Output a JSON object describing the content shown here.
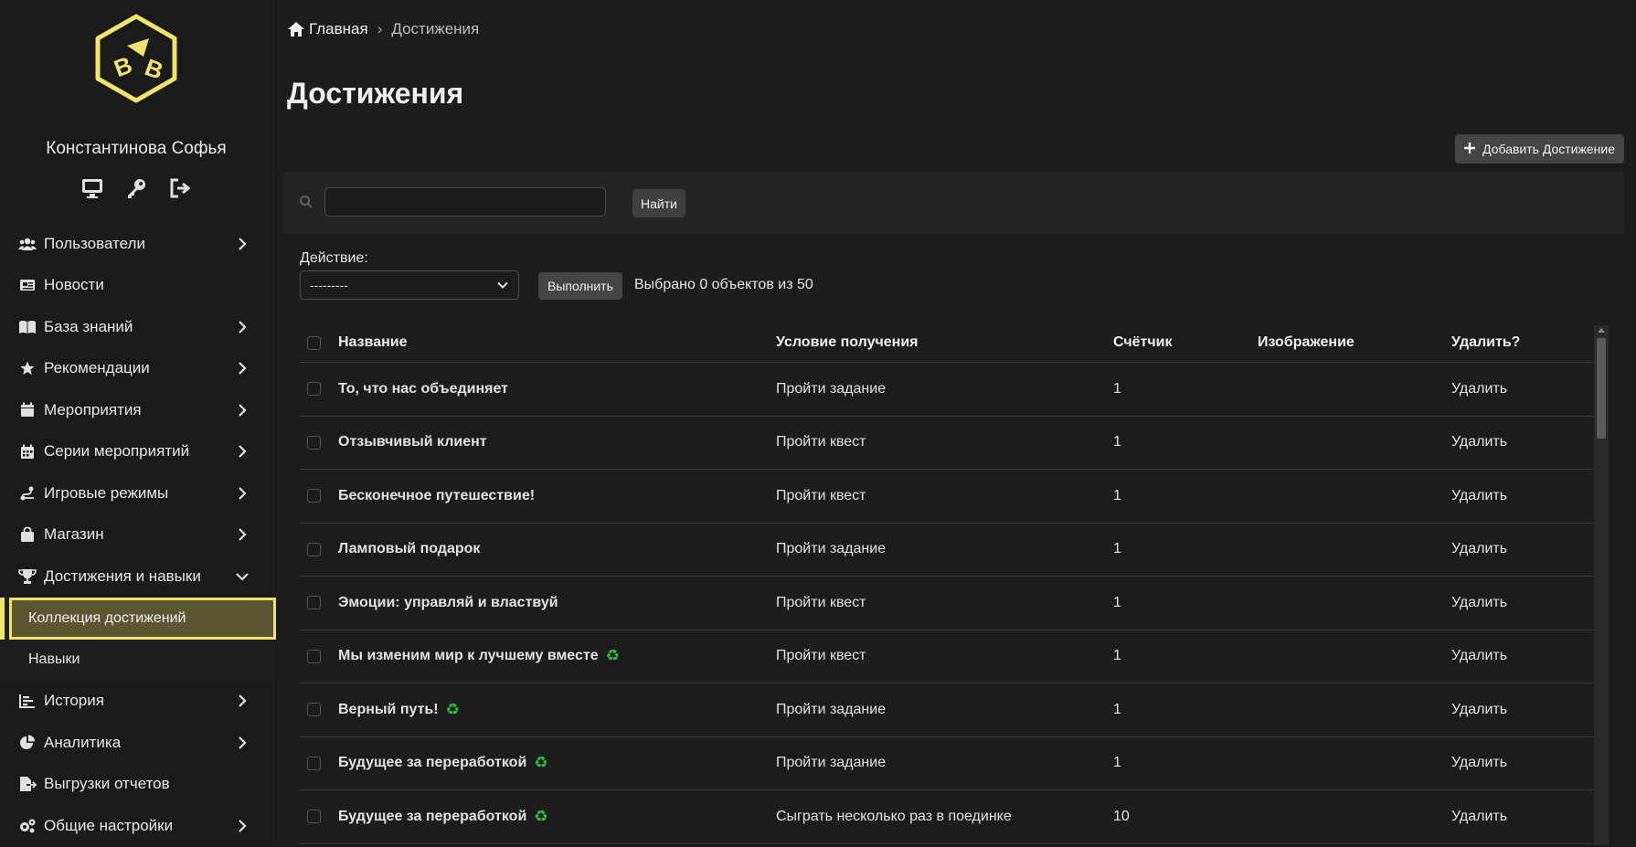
{
  "sidebar": {
    "user_name": "Константинова Софья",
    "user_icons": [
      "monitor-icon",
      "key-icon",
      "logout-icon"
    ],
    "nav": [
      {
        "label": "Пользователи",
        "icon": "users-icon",
        "expandable": true
      },
      {
        "label": "Новости",
        "icon": "newspaper-icon",
        "expandable": false
      },
      {
        "label": "База знаний",
        "icon": "book-icon",
        "expandable": true
      },
      {
        "label": "Рекомендации",
        "icon": "star-icon",
        "expandable": true
      },
      {
        "label": "Мероприятия",
        "icon": "calendar-icon",
        "expandable": true
      },
      {
        "label": "Серии мероприятий",
        "icon": "calendar-grid-icon",
        "expandable": true
      },
      {
        "label": "Игровые режимы",
        "icon": "route-icon",
        "expandable": true
      },
      {
        "label": "Магазин",
        "icon": "shopping-bag-icon",
        "expandable": true
      },
      {
        "label": "Достижения и навыки",
        "icon": "trophy-icon",
        "expandable": true,
        "expanded": true
      },
      {
        "label": "История",
        "icon": "chart-bars-icon",
        "expandable": true
      },
      {
        "label": "Аналитика",
        "icon": "pie-chart-icon",
        "expandable": true
      },
      {
        "label": "Выгрузки отчетов",
        "icon": "file-export-icon",
        "expandable": false
      },
      {
        "label": "Общие настройки",
        "icon": "cogs-icon",
        "expandable": true
      }
    ],
    "subnav": [
      {
        "label": "Коллекция достижений",
        "active": true
      },
      {
        "label": "Навыки",
        "active": false
      }
    ],
    "accent_color": "#f2e36a"
  },
  "breadcrumb": {
    "home": "Главная",
    "separator": "›",
    "current": "Достижения"
  },
  "page_title": "Достижения",
  "add_button": "Добавить Достижение",
  "search": {
    "value": "",
    "button": "Найти"
  },
  "actions": {
    "label": "Действие:",
    "selected": "---------",
    "run_button": "Выполнить",
    "selected_count": "Выбрано 0 объектов из 50"
  },
  "table": {
    "headers": [
      "Название",
      "Условие получения",
      "Счётчик",
      "Изображение",
      "Удалить?"
    ],
    "rows": [
      {
        "name": "То, что нас объединяет",
        "eco": false,
        "condition": "Пройти задание",
        "counter": "1",
        "image": "",
        "delete": "Удалить"
      },
      {
        "name": "Отзывчивый клиент",
        "eco": false,
        "condition": "Пройти квест",
        "counter": "1",
        "image": "",
        "delete": "Удалить"
      },
      {
        "name": "Бесконечное путешествие!",
        "eco": false,
        "condition": "Пройти квест",
        "counter": "1",
        "image": "",
        "delete": "Удалить"
      },
      {
        "name": "Ламповый подарок",
        "eco": false,
        "condition": "Пройти задание",
        "counter": "1",
        "image": "",
        "delete": "Удалить"
      },
      {
        "name": "Эмоции: управляй и властвуй",
        "eco": false,
        "condition": "Пройти квест",
        "counter": "1",
        "image": "",
        "delete": "Удалить"
      },
      {
        "name": "Мы изменим мир к лучшему вместе",
        "eco": true,
        "condition": "Пройти квест",
        "counter": "1",
        "image": "",
        "delete": "Удалить"
      },
      {
        "name": "Верный путь!",
        "eco": true,
        "condition": "Пройти задание",
        "counter": "1",
        "image": "",
        "delete": "Удалить"
      },
      {
        "name": "Будущее за переработкой",
        "eco": true,
        "condition": "Пройти задание",
        "counter": "1",
        "image": "",
        "delete": "Удалить"
      },
      {
        "name": "Будущее за переработкой",
        "eco": true,
        "condition": "Сыграть несколько раз в поединке",
        "counter": "10",
        "image": "",
        "delete": "Удалить"
      }
    ],
    "eco_glyph": "♻"
  }
}
